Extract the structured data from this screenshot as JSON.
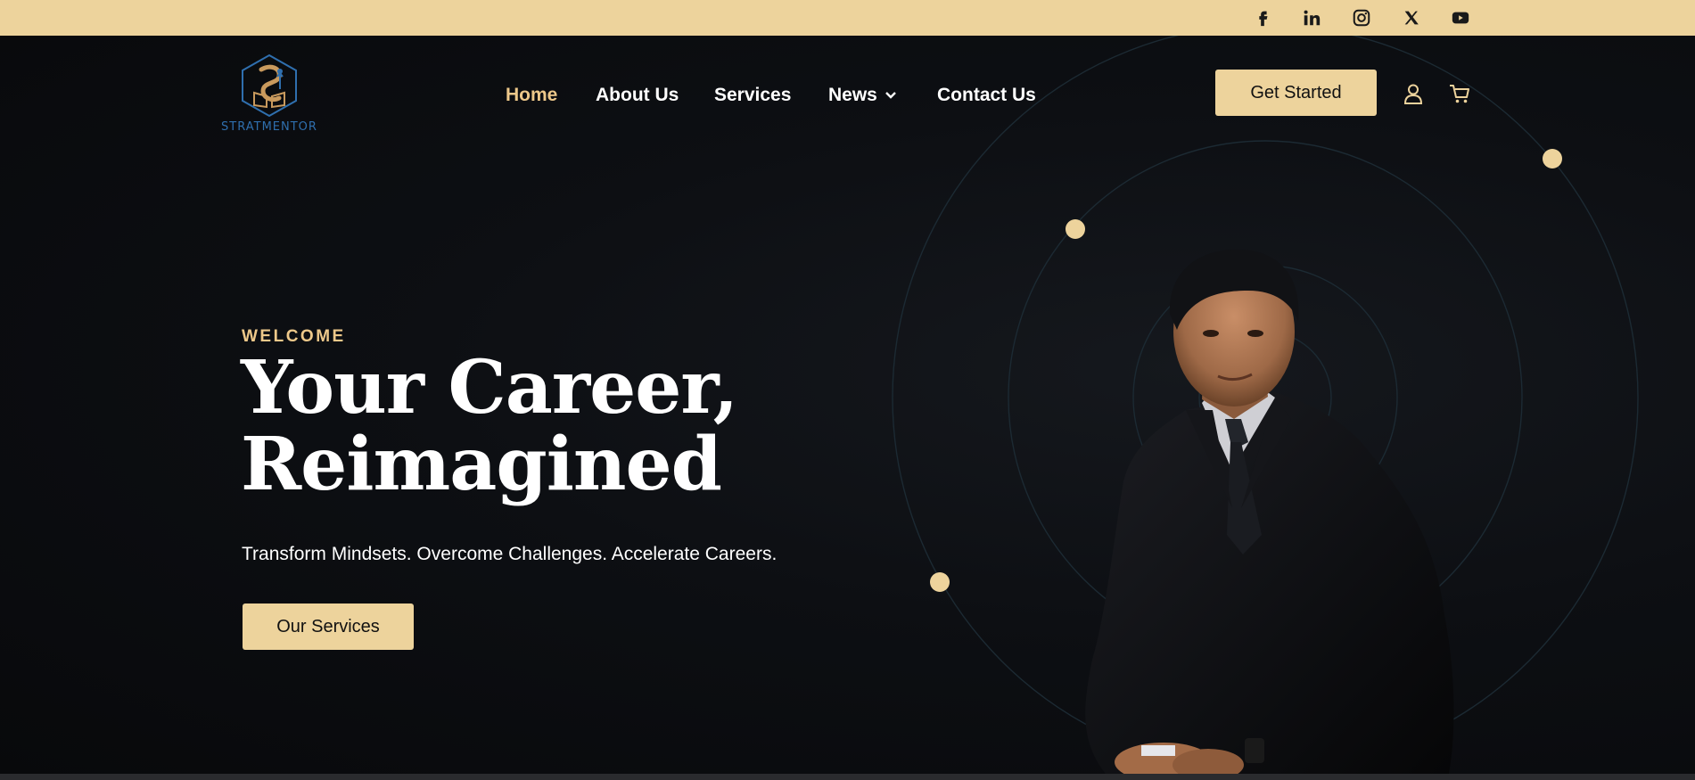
{
  "colors": {
    "accent": "#edd39c",
    "accent_text": "#edc88a",
    "background": "#0b0c0f",
    "logo_blue": "#2f6fae",
    "orbit_line": "#1c2a33"
  },
  "topbar": {
    "social_icons": [
      "facebook-icon",
      "linkedin-icon",
      "instagram-icon",
      "x-icon",
      "youtube-icon"
    ]
  },
  "header": {
    "logo_text": "STRATMENTOR",
    "nav": [
      {
        "label": "Home",
        "active": true
      },
      {
        "label": "About Us",
        "active": false
      },
      {
        "label": "Services",
        "active": false
      },
      {
        "label": "News",
        "active": false,
        "has_dropdown": true
      },
      {
        "label": "Contact Us",
        "active": false
      }
    ],
    "cta_label": "Get Started",
    "icons": [
      "user-icon",
      "cart-icon"
    ]
  },
  "hero": {
    "eyebrow": "WELCOME",
    "title_line1": "Your Career,",
    "title_line2": "Reimagined",
    "subtitle": "Transform Mindsets. Overcome Challenges. Accelerate Careers.",
    "button_label": "Our Services"
  }
}
